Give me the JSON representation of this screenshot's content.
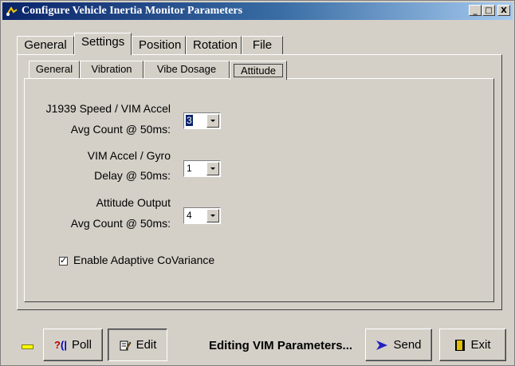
{
  "window": {
    "title": "Configure Vehicle Inertia Monitor Parameters",
    "controls": [
      "_",
      "□",
      "X"
    ]
  },
  "tabs": [
    {
      "label": "General",
      "active": false
    },
    {
      "label": "Settings",
      "active": true
    },
    {
      "label": "Position",
      "active": false
    },
    {
      "label": "Rotation",
      "active": false
    },
    {
      "label": "File",
      "active": false
    }
  ],
  "subtabs": [
    {
      "label": "General",
      "active": false
    },
    {
      "label": "Vibration",
      "active": false
    },
    {
      "label": "Vibe Dosage",
      "active": false
    },
    {
      "label": "Attitude",
      "active": true
    }
  ],
  "fields": [
    {
      "line1": "J1939 Speed / VIM Accel",
      "line2": "Avg Count @ 50ms:",
      "value": "3",
      "selected": true
    },
    {
      "line1": "VIM Accel / Gyro",
      "line2": "Delay @ 50ms:",
      "value": "1",
      "selected": false
    },
    {
      "line1": "Attitude Output",
      "line2": "Avg Count @ 50ms:",
      "value": "4",
      "selected": false
    }
  ],
  "checkbox": {
    "label": "Enable Adaptive CoVariance",
    "checked": true
  },
  "footer": {
    "poll_label": "Poll",
    "edit_label": "Edit",
    "status_text": "Editing VIM Parameters...",
    "send_label": "Send",
    "exit_label": "Exit",
    "indicator_color": "#ffff00"
  }
}
